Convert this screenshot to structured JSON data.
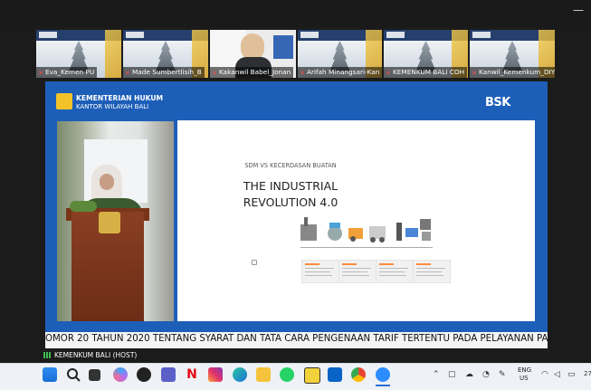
{
  "window": {
    "minimize_glyph": "—"
  },
  "participants": [
    {
      "name": "Eva_Kemen PU",
      "muted": true
    },
    {
      "name": "Made Sumbertlisih_B",
      "muted": true
    },
    {
      "name": "Kakanwil Babel_Jonan",
      "muted": true
    },
    {
      "name": "Arifah Minangsari-Kan",
      "muted": true
    },
    {
      "name": "KEMENKUM BALI COH",
      "muted": true
    },
    {
      "name": "Kanwil_Kemenkum_DIY",
      "muted": true
    }
  ],
  "banner": {
    "org_line1": "KEMENTERIAN HUKUM",
    "org_line2": "KANTOR WILAYAH BALI",
    "brand": "BSK"
  },
  "slide": {
    "subtitle": "SDM VS KECERDASAN BUATAN",
    "title_line1": "THE INDUSTRIAL",
    "title_line2": "REVOLUTION 4.0",
    "stages": [
      "INDUSTRY 1.0",
      "INDUSTRY 2.0",
      "INDUSTRY 3.0",
      "INDUSTRY 4.0"
    ]
  },
  "ticker": {
    "text": "OMOR 20 TAHUN 2020 TENTANG SYARAT DAN TATA CARA PENGENAAN TARIF TERTENTU PADA PELAYANAN PATEN DAN"
  },
  "host_label": "KEMENKUM BALI (HOST)",
  "taskbar": {
    "icons": [
      "windows-start-icon",
      "search-icon",
      "task-view-icon",
      "copilot-icon",
      "chatgpt-icon",
      "teams-icon",
      "netflix-icon",
      "instagram-icon",
      "edge-icon",
      "file-explorer-icon",
      "whatsapp-icon",
      "app-icon",
      "outlook-icon",
      "chrome-icon",
      "zoom-icon"
    ],
    "lang_line1": "ENG",
    "lang_line2": "US",
    "clock_partial": "27"
  },
  "colors": {
    "banner_blue": "#1d5fb8",
    "accent_orange": "#ff8a3d",
    "mute_red": "#ff4d4d"
  }
}
